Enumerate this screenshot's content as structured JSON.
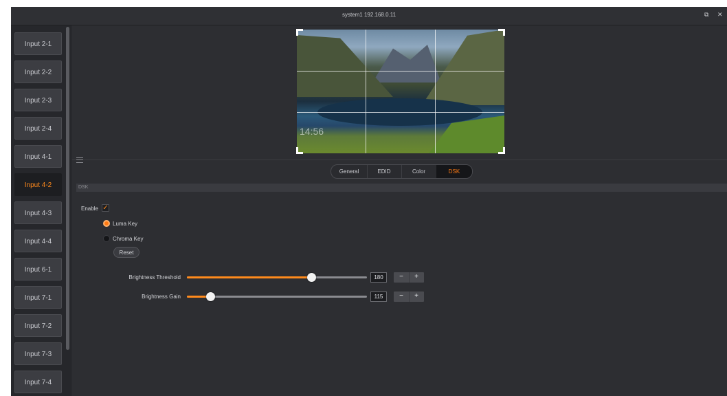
{
  "window": {
    "title": "system1 192.168.0.11",
    "restore_icon": "restore-icon",
    "close_icon": "close-icon",
    "restore_glyph": "⧉",
    "close_glyph": "✕"
  },
  "sidebar": {
    "items": [
      {
        "label": "Input 2-1"
      },
      {
        "label": "Input 2-2"
      },
      {
        "label": "Input 2-3"
      },
      {
        "label": "Input 2-4"
      },
      {
        "label": "Input 4-1"
      },
      {
        "label": "Input 4-2",
        "active": true
      },
      {
        "label": "Input 4-3"
      },
      {
        "label": "Input 4-4"
      },
      {
        "label": "Input 6-1"
      },
      {
        "label": "Input 7-1"
      },
      {
        "label": "Input 7-2"
      },
      {
        "label": "Input 7-3"
      },
      {
        "label": "Input 7-4"
      }
    ]
  },
  "preview": {
    "clock_text": "14:56"
  },
  "tabs": [
    {
      "label": "General"
    },
    {
      "label": "EDID"
    },
    {
      "label": "Color"
    },
    {
      "label": "DSK",
      "active": true
    }
  ],
  "dsk": {
    "section_title": "DSK",
    "enable_label": "Enable",
    "enable_checked": true,
    "check_glyph": "✓",
    "luma_label": "Luma Key",
    "chroma_label": "Chroma Key",
    "selected_mode": "Luma Key",
    "reset_label": "Reset",
    "threshold": {
      "label": "Brightness Threshold",
      "value": "180",
      "fraction": 0.69
    },
    "gain": {
      "label": "Brightness Gain",
      "value": "115",
      "fraction": 0.13
    },
    "minus_label": "−",
    "plus_label": "+"
  },
  "colors": {
    "accent": "#ff8a1c"
  }
}
